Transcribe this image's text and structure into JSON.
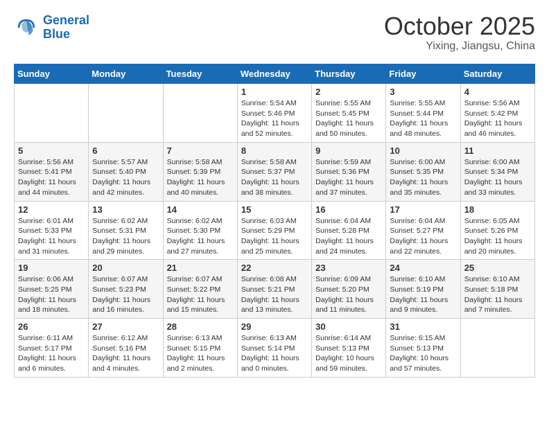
{
  "logo": {
    "text_general": "General",
    "text_blue": "Blue"
  },
  "header": {
    "month": "October 2025",
    "location": "Yixing, Jiangsu, China"
  },
  "weekdays": [
    "Sunday",
    "Monday",
    "Tuesday",
    "Wednesday",
    "Thursday",
    "Friday",
    "Saturday"
  ],
  "weeks": [
    [
      {
        "day": "",
        "info": ""
      },
      {
        "day": "",
        "info": ""
      },
      {
        "day": "",
        "info": ""
      },
      {
        "day": "1",
        "info": "Sunrise: 5:54 AM\nSunset: 5:46 PM\nDaylight: 11 hours\nand 52 minutes."
      },
      {
        "day": "2",
        "info": "Sunrise: 5:55 AM\nSunset: 5:45 PM\nDaylight: 11 hours\nand 50 minutes."
      },
      {
        "day": "3",
        "info": "Sunrise: 5:55 AM\nSunset: 5:44 PM\nDaylight: 11 hours\nand 48 minutes."
      },
      {
        "day": "4",
        "info": "Sunrise: 5:56 AM\nSunset: 5:42 PM\nDaylight: 11 hours\nand 46 minutes."
      }
    ],
    [
      {
        "day": "5",
        "info": "Sunrise: 5:56 AM\nSunset: 5:41 PM\nDaylight: 11 hours\nand 44 minutes."
      },
      {
        "day": "6",
        "info": "Sunrise: 5:57 AM\nSunset: 5:40 PM\nDaylight: 11 hours\nand 42 minutes."
      },
      {
        "day": "7",
        "info": "Sunrise: 5:58 AM\nSunset: 5:39 PM\nDaylight: 11 hours\nand 40 minutes."
      },
      {
        "day": "8",
        "info": "Sunrise: 5:58 AM\nSunset: 5:37 PM\nDaylight: 11 hours\nand 38 minutes."
      },
      {
        "day": "9",
        "info": "Sunrise: 5:59 AM\nSunset: 5:36 PM\nDaylight: 11 hours\nand 37 minutes."
      },
      {
        "day": "10",
        "info": "Sunrise: 6:00 AM\nSunset: 5:35 PM\nDaylight: 11 hours\nand 35 minutes."
      },
      {
        "day": "11",
        "info": "Sunrise: 6:00 AM\nSunset: 5:34 PM\nDaylight: 11 hours\nand 33 minutes."
      }
    ],
    [
      {
        "day": "12",
        "info": "Sunrise: 6:01 AM\nSunset: 5:33 PM\nDaylight: 11 hours\nand 31 minutes."
      },
      {
        "day": "13",
        "info": "Sunrise: 6:02 AM\nSunset: 5:31 PM\nDaylight: 11 hours\nand 29 minutes."
      },
      {
        "day": "14",
        "info": "Sunrise: 6:02 AM\nSunset: 5:30 PM\nDaylight: 11 hours\nand 27 minutes."
      },
      {
        "day": "15",
        "info": "Sunrise: 6:03 AM\nSunset: 5:29 PM\nDaylight: 11 hours\nand 25 minutes."
      },
      {
        "day": "16",
        "info": "Sunrise: 6:04 AM\nSunset: 5:28 PM\nDaylight: 11 hours\nand 24 minutes."
      },
      {
        "day": "17",
        "info": "Sunrise: 6:04 AM\nSunset: 5:27 PM\nDaylight: 11 hours\nand 22 minutes."
      },
      {
        "day": "18",
        "info": "Sunrise: 6:05 AM\nSunset: 5:26 PM\nDaylight: 11 hours\nand 20 minutes."
      }
    ],
    [
      {
        "day": "19",
        "info": "Sunrise: 6:06 AM\nSunset: 5:25 PM\nDaylight: 11 hours\nand 18 minutes."
      },
      {
        "day": "20",
        "info": "Sunrise: 6:07 AM\nSunset: 5:23 PM\nDaylight: 11 hours\nand 16 minutes."
      },
      {
        "day": "21",
        "info": "Sunrise: 6:07 AM\nSunset: 5:22 PM\nDaylight: 11 hours\nand 15 minutes."
      },
      {
        "day": "22",
        "info": "Sunrise: 6:08 AM\nSunset: 5:21 PM\nDaylight: 11 hours\nand 13 minutes."
      },
      {
        "day": "23",
        "info": "Sunrise: 6:09 AM\nSunset: 5:20 PM\nDaylight: 11 hours\nand 11 minutes."
      },
      {
        "day": "24",
        "info": "Sunrise: 6:10 AM\nSunset: 5:19 PM\nDaylight: 11 hours\nand 9 minutes."
      },
      {
        "day": "25",
        "info": "Sunrise: 6:10 AM\nSunset: 5:18 PM\nDaylight: 11 hours\nand 7 minutes."
      }
    ],
    [
      {
        "day": "26",
        "info": "Sunrise: 6:11 AM\nSunset: 5:17 PM\nDaylight: 11 hours\nand 6 minutes."
      },
      {
        "day": "27",
        "info": "Sunrise: 6:12 AM\nSunset: 5:16 PM\nDaylight: 11 hours\nand 4 minutes."
      },
      {
        "day": "28",
        "info": "Sunrise: 6:13 AM\nSunset: 5:15 PM\nDaylight: 11 hours\nand 2 minutes."
      },
      {
        "day": "29",
        "info": "Sunrise: 6:13 AM\nSunset: 5:14 PM\nDaylight: 11 hours\nand 0 minutes."
      },
      {
        "day": "30",
        "info": "Sunrise: 6:14 AM\nSunset: 5:13 PM\nDaylight: 10 hours\nand 59 minutes."
      },
      {
        "day": "31",
        "info": "Sunrise: 6:15 AM\nSunset: 5:13 PM\nDaylight: 10 hours\nand 57 minutes."
      },
      {
        "day": "",
        "info": ""
      }
    ]
  ]
}
